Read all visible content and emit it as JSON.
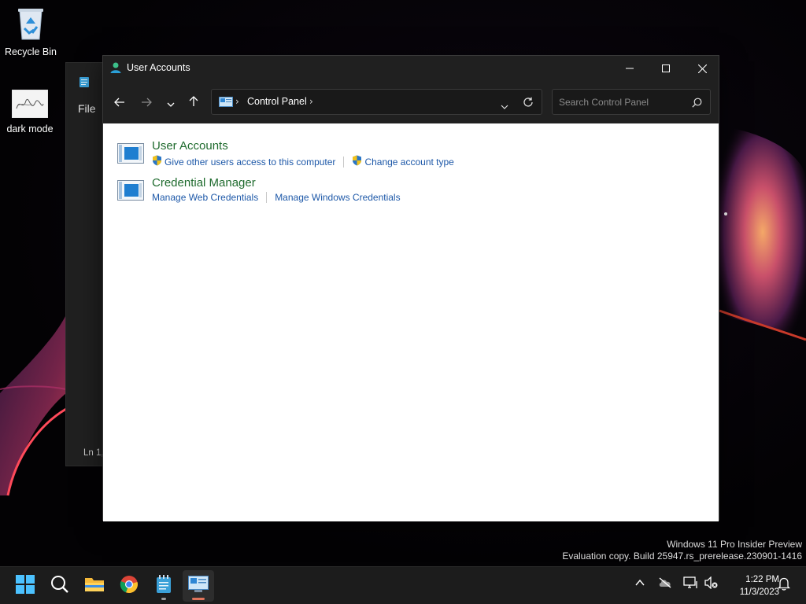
{
  "desktop": {
    "icons": [
      {
        "label": "Recycle Bin",
        "icon": "recycle-bin-icon"
      },
      {
        "label": "dark mode",
        "icon": "image-thumbnail-icon"
      }
    ]
  },
  "notepad": {
    "menu_file": "File",
    "status": "Ln 1,"
  },
  "window": {
    "title": "User Accounts",
    "icon": "user-accounts-icon",
    "controls": {
      "minimize": "minimize-icon",
      "maximize": "maximize-icon",
      "close": "close-icon"
    }
  },
  "navigation": {
    "back": "back-arrow-icon",
    "forward": "forward-arrow-icon",
    "recent": "chevron-down-icon",
    "up": "up-arrow-icon",
    "breadcrumb": [
      "Control Panel"
    ],
    "search_placeholder": "Search Control Panel"
  },
  "categories": [
    {
      "title": "User Accounts",
      "links": [
        {
          "label": "Give other users access to this computer",
          "shield": true
        },
        {
          "label": "Change account type",
          "shield": true
        }
      ]
    },
    {
      "title": "Credential Manager",
      "links": [
        {
          "label": "Manage Web Credentials",
          "shield": false
        },
        {
          "label": "Manage Windows Credentials",
          "shield": false
        }
      ]
    }
  ],
  "watermark": {
    "line1": "Windows 11 Pro Insider Preview",
    "line2": "Evaluation copy. Build 25947.rs_prerelease.230901-1416"
  },
  "taskbar": {
    "apps": [
      "start-icon",
      "search-icon",
      "file-explorer-icon",
      "chrome-icon",
      "notepad-icon",
      "control-panel-icon"
    ],
    "tray": [
      "chevron-up-icon",
      "onedrive-offline-icon",
      "network-icon",
      "volume-muted-icon",
      "notification-bell-icon"
    ],
    "time": "1:22 PM",
    "date": "11/3/2023"
  },
  "colors": {
    "category_title": "#1f6b2e",
    "link": "#1d58a8",
    "titlebar": "#202020",
    "taskbar": "#1c1c1c",
    "active_indicator": "#e0745b"
  }
}
